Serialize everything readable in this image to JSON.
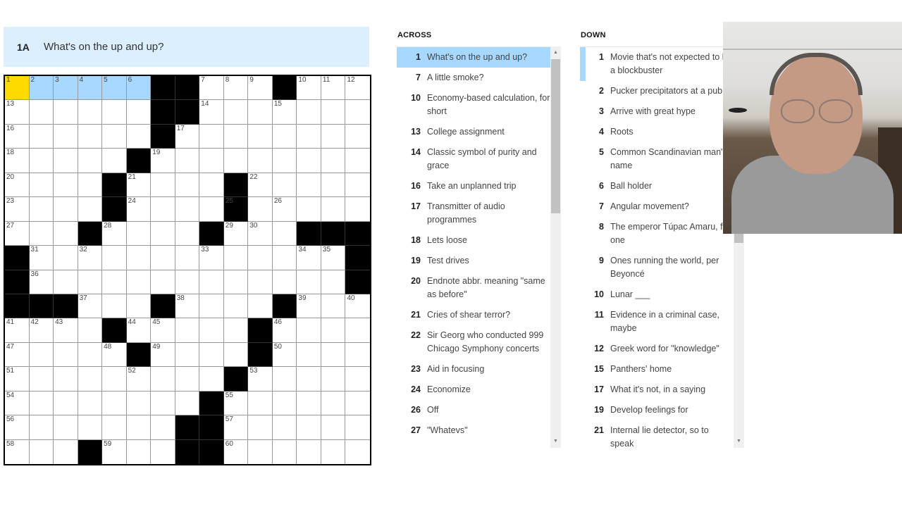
{
  "current_clue": {
    "label": "1A",
    "text": "What's on the up and up?"
  },
  "colors": {
    "active_cell": "#ffda00",
    "word_highlight": "#a7d8ff",
    "clue_bar": "#dcefff"
  },
  "grid": {
    "rows": 16,
    "cols": 15,
    "active_cell": [
      0,
      0
    ],
    "highlighted_word_cells": [
      [
        0,
        1
      ],
      [
        0,
        2
      ],
      [
        0,
        3
      ],
      [
        0,
        4
      ],
      [
        0,
        5
      ]
    ],
    "layout": [
      "......##...#...",
      "......##.......",
      "......#........",
      ".....#.........",
      "....#....#.....",
      "....#....#.....",
      "...#....#...###",
      "#.............#",
      "#.............#",
      "###...#....#...",
      "....#.....#....",
      ".....#....#....",
      ".........#.....",
      "........#......",
      ".......##......",
      "...#...##......"
    ],
    "numbers": [
      {
        "r": 0,
        "c": 0,
        "n": "1"
      },
      {
        "r": 0,
        "c": 1,
        "n": "2"
      },
      {
        "r": 0,
        "c": 2,
        "n": "3"
      },
      {
        "r": 0,
        "c": 3,
        "n": "4"
      },
      {
        "r": 0,
        "c": 4,
        "n": "5"
      },
      {
        "r": 0,
        "c": 5,
        "n": "6"
      },
      {
        "r": 0,
        "c": 8,
        "n": "7"
      },
      {
        "r": 0,
        "c": 9,
        "n": "8"
      },
      {
        "r": 0,
        "c": 10,
        "n": "9"
      },
      {
        "r": 0,
        "c": 12,
        "n": "10"
      },
      {
        "r": 0,
        "c": 13,
        "n": "11"
      },
      {
        "r": 0,
        "c": 14,
        "n": "12"
      },
      {
        "r": 1,
        "c": 0,
        "n": "13"
      },
      {
        "r": 1,
        "c": 8,
        "n": "14"
      },
      {
        "r": 1,
        "c": 11,
        "n": "15"
      },
      {
        "r": 2,
        "c": 0,
        "n": "16"
      },
      {
        "r": 2,
        "c": 7,
        "n": "17"
      },
      {
        "r": 3,
        "c": 0,
        "n": "18"
      },
      {
        "r": 3,
        "c": 6,
        "n": "19"
      },
      {
        "r": 4,
        "c": 0,
        "n": "20"
      },
      {
        "r": 4,
        "c": 5,
        "n": "21"
      },
      {
        "r": 4,
        "c": 10,
        "n": "22"
      },
      {
        "r": 5,
        "c": 0,
        "n": "23"
      },
      {
        "r": 5,
        "c": 5,
        "n": "24"
      },
      {
        "r": 5,
        "c": 9,
        "n": "25"
      },
      {
        "r": 5,
        "c": 11,
        "n": "26"
      },
      {
        "r": 6,
        "c": 0,
        "n": "27"
      },
      {
        "r": 6,
        "c": 4,
        "n": "28"
      },
      {
        "r": 6,
        "c": 9,
        "n": "29"
      },
      {
        "r": 6,
        "c": 10,
        "n": "30"
      },
      {
        "r": 7,
        "c": 1,
        "n": "31"
      },
      {
        "r": 7,
        "c": 3,
        "n": "32"
      },
      {
        "r": 7,
        "c": 8,
        "n": "33"
      },
      {
        "r": 7,
        "c": 12,
        "n": "34"
      },
      {
        "r": 7,
        "c": 13,
        "n": "35"
      },
      {
        "r": 8,
        "c": 1,
        "n": "36"
      },
      {
        "r": 9,
        "c": 3,
        "n": "37"
      },
      {
        "r": 9,
        "c": 7,
        "n": "38"
      },
      {
        "r": 9,
        "c": 12,
        "n": "39"
      },
      {
        "r": 9,
        "c": 14,
        "n": "40"
      },
      {
        "r": 10,
        "c": 0,
        "n": "41"
      },
      {
        "r": 10,
        "c": 1,
        "n": "42"
      },
      {
        "r": 10,
        "c": 2,
        "n": "43"
      },
      {
        "r": 10,
        "c": 5,
        "n": "44"
      },
      {
        "r": 10,
        "c": 6,
        "n": "45"
      },
      {
        "r": 10,
        "c": 11,
        "n": "46"
      },
      {
        "r": 11,
        "c": 0,
        "n": "47"
      },
      {
        "r": 11,
        "c": 4,
        "n": "48"
      },
      {
        "r": 11,
        "c": 6,
        "n": "49"
      },
      {
        "r": 11,
        "c": 11,
        "n": "50"
      },
      {
        "r": 12,
        "c": 0,
        "n": "51"
      },
      {
        "r": 12,
        "c": 5,
        "n": "52"
      },
      {
        "r": 12,
        "c": 10,
        "n": "53"
      },
      {
        "r": 13,
        "c": 0,
        "n": "54"
      },
      {
        "r": 13,
        "c": 9,
        "n": "55"
      },
      {
        "r": 14,
        "c": 0,
        "n": "56"
      },
      {
        "r": 14,
        "c": 9,
        "n": "57"
      },
      {
        "r": 15,
        "c": 0,
        "n": "58"
      },
      {
        "r": 15,
        "c": 4,
        "n": "59"
      },
      {
        "r": 15,
        "c": 9,
        "n": "60"
      }
    ]
  },
  "across": {
    "header": "ACROSS",
    "selected": "1",
    "clues": [
      {
        "n": "1",
        "t": "What's on the up and up?"
      },
      {
        "n": "7",
        "t": "A little smoke?"
      },
      {
        "n": "10",
        "t": "Economy-based calculation, for short"
      },
      {
        "n": "13",
        "t": "College assignment"
      },
      {
        "n": "14",
        "t": "Classic symbol of purity and grace"
      },
      {
        "n": "16",
        "t": "Take an unplanned trip"
      },
      {
        "n": "17",
        "t": "Transmitter of audio programmes"
      },
      {
        "n": "18",
        "t": "Lets loose"
      },
      {
        "n": "19",
        "t": "Test drives"
      },
      {
        "n": "20",
        "t": "Endnote abbr. meaning \"same as before\""
      },
      {
        "n": "21",
        "t": "Cries of shear terror?"
      },
      {
        "n": "22",
        "t": "Sir Georg who conducted 999 Chicago Symphony concerts"
      },
      {
        "n": "23",
        "t": "Aid in focusing"
      },
      {
        "n": "24",
        "t": "Economize"
      },
      {
        "n": "26",
        "t": "Off"
      },
      {
        "n": "27",
        "t": "\"Whatevs\""
      }
    ]
  },
  "down": {
    "header": "DOWN",
    "crossing": "1",
    "clues": [
      {
        "n": "1",
        "t": "Movie that's not expected to be a blockbuster"
      },
      {
        "n": "2",
        "t": "Pucker precipitators at a pub"
      },
      {
        "n": "3",
        "t": "Arrive with great hype"
      },
      {
        "n": "4",
        "t": "Roots"
      },
      {
        "n": "5",
        "t": "Common Scandinavian man's name"
      },
      {
        "n": "6",
        "t": "Ball holder"
      },
      {
        "n": "7",
        "t": "Angular movement?"
      },
      {
        "n": "8",
        "t": "The emperor Túpac Amaru, for one"
      },
      {
        "n": "9",
        "t": "Ones running the world, per Beyoncé"
      },
      {
        "n": "10",
        "t": "Lunar ___"
      },
      {
        "n": "11",
        "t": "Evidence in a criminal case, maybe"
      },
      {
        "n": "12",
        "t": "Greek word for \"knowledge\""
      },
      {
        "n": "15",
        "t": "Panthers' home"
      },
      {
        "n": "17",
        "t": "What it's not, in a saying"
      },
      {
        "n": "19",
        "t": "Develop feelings for"
      },
      {
        "n": "21",
        "t": "Internal lie detector, so to speak"
      }
    ]
  },
  "scroll": {
    "up_arrow": "▲",
    "down_arrow": "▼"
  },
  "webcam": {
    "label": "webcam-feed"
  }
}
